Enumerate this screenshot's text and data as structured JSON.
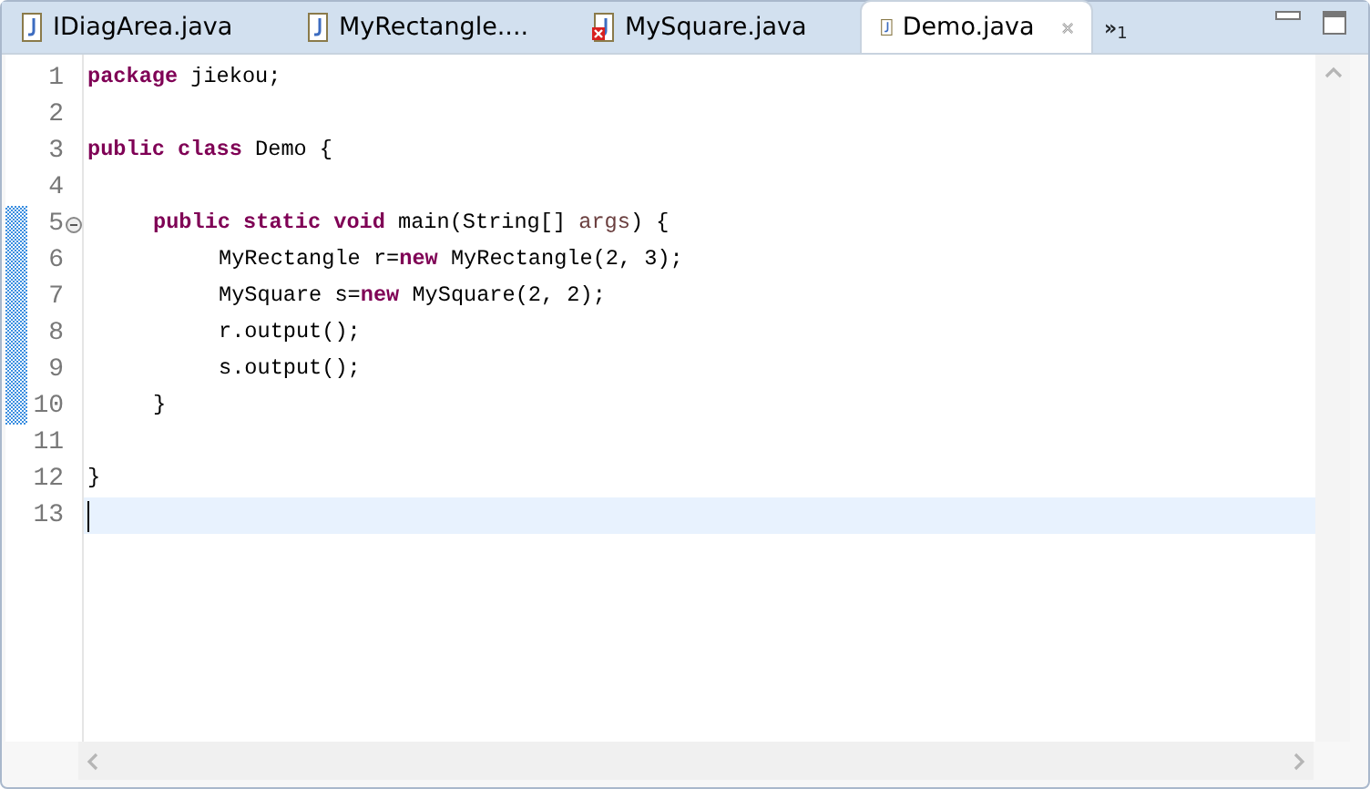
{
  "tabs": [
    {
      "label": "IDiagArea.java",
      "selected": false,
      "error": false
    },
    {
      "label": "MyRectangle....",
      "selected": false,
      "error": false
    },
    {
      "label": "MySquare.java",
      "selected": false,
      "error": true
    },
    {
      "label": "Demo.java",
      "selected": true,
      "error": false
    }
  ],
  "overflow": {
    "glyph": "»",
    "count": "1"
  },
  "lines": [
    {
      "number": "1",
      "current": false,
      "changed": false,
      "foldable": false,
      "tokens": [
        {
          "text": "package",
          "kind": "keyword"
        },
        {
          "text": " jiekou;",
          "kind": "plain"
        }
      ]
    },
    {
      "number": "2",
      "current": false,
      "changed": false,
      "foldable": false
    },
    {
      "number": "3",
      "current": false,
      "changed": false,
      "foldable": false,
      "tokens": [
        {
          "text": "public class",
          "kind": "keyword"
        },
        {
          "text": " Demo {",
          "kind": "plain"
        }
      ]
    },
    {
      "number": "4",
      "current": false,
      "changed": false,
      "foldable": false
    },
    {
      "number": "5",
      "current": false,
      "changed": true,
      "foldable": true,
      "tokens": [
        {
          "text": "\tpublic static void",
          "kind": "keyword"
        },
        {
          "text": " main(String[] ",
          "kind": "plain"
        },
        {
          "text": "args",
          "kind": "variable"
        },
        {
          "text": ") {",
          "kind": "plain"
        }
      ]
    },
    {
      "number": "6",
      "current": false,
      "changed": true,
      "foldable": false,
      "tokens": [
        {
          "text": "\t\tMyRectangle r=",
          "kind": "plain"
        },
        {
          "text": "new",
          "kind": "keyword"
        },
        {
          "text": " MyRectangle(2, 3);",
          "kind": "plain"
        }
      ]
    },
    {
      "number": "7",
      "current": false,
      "changed": true,
      "foldable": false,
      "tokens": [
        {
          "text": "\t\tMySquare s=",
          "kind": "plain"
        },
        {
          "text": "new",
          "kind": "keyword"
        },
        {
          "text": " MySquare(2, 2);",
          "kind": "plain"
        }
      ]
    },
    {
      "number": "8",
      "current": false,
      "changed": true,
      "foldable": false,
      "tokens": [
        {
          "text": "\t\tr.output();",
          "kind": "plain"
        }
      ]
    },
    {
      "number": "9",
      "current": false,
      "changed": true,
      "foldable": false,
      "tokens": [
        {
          "text": "\t\ts.output();",
          "kind": "plain"
        }
      ]
    },
    {
      "number": "10",
      "current": false,
      "changed": true,
      "foldable": false,
      "tokens": [
        {
          "text": "\t}",
          "kind": "plain"
        }
      ]
    },
    {
      "number": "11",
      "current": false,
      "changed": false,
      "foldable": false
    },
    {
      "number": "12",
      "current": false,
      "changed": false,
      "foldable": false,
      "tokens": [
        {
          "text": "}",
          "kind": "plain"
        }
      ]
    },
    {
      "number": "13",
      "current": true,
      "changed": false,
      "foldable": false
    }
  ]
}
